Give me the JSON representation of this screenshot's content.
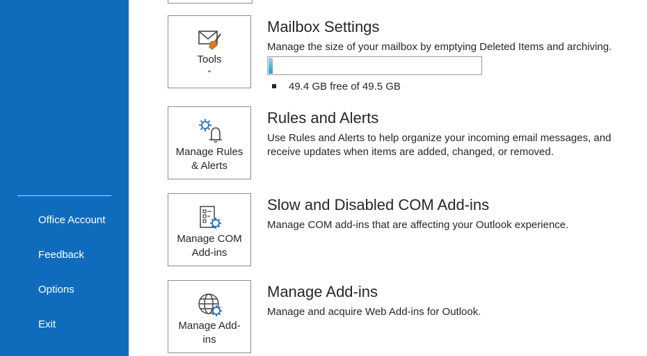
{
  "nav": {
    "items": [
      {
        "label": "Office Account"
      },
      {
        "label": "Feedback"
      },
      {
        "label": "Options"
      },
      {
        "label": "Exit"
      }
    ],
    "background_color": "#0f6cbd"
  },
  "sections": {
    "mailbox": {
      "tile_label": "Tools",
      "tile_icon": "mail-broom-icon",
      "title": "Mailbox Settings",
      "description": "Manage the size of your mailbox by emptying Deleted Items and archiving.",
      "usage_fraction": 0.02,
      "free_text": "49.4 GB free of 49.5 GB"
    },
    "rules": {
      "tile_label_line1": "Manage Rules",
      "tile_label_line2": "& Alerts",
      "tile_icon": "gear-bell-icon",
      "title": "Rules and Alerts",
      "description": "Use Rules and Alerts to help organize your incoming email messages, and receive updates when items are added, changed, or removed."
    },
    "com_addins": {
      "tile_label_line1": "Manage COM",
      "tile_label_line2": "Add-ins",
      "tile_icon": "checklist-gear-icon",
      "title": "Slow and Disabled COM Add-ins",
      "description": "Manage COM add-ins that are affecting your Outlook experience."
    },
    "addins": {
      "tile_label_line1": "Manage Add-",
      "tile_label_line2": "ins",
      "tile_icon": "globe-gear-icon",
      "title": "Manage Add-ins",
      "description": "Manage and acquire Web Add-ins for Outlook."
    }
  },
  "colors": {
    "accent": "#0f6cbd",
    "icon_blue": "#1f6fc9",
    "progress_fill": "#2e9dc6"
  }
}
